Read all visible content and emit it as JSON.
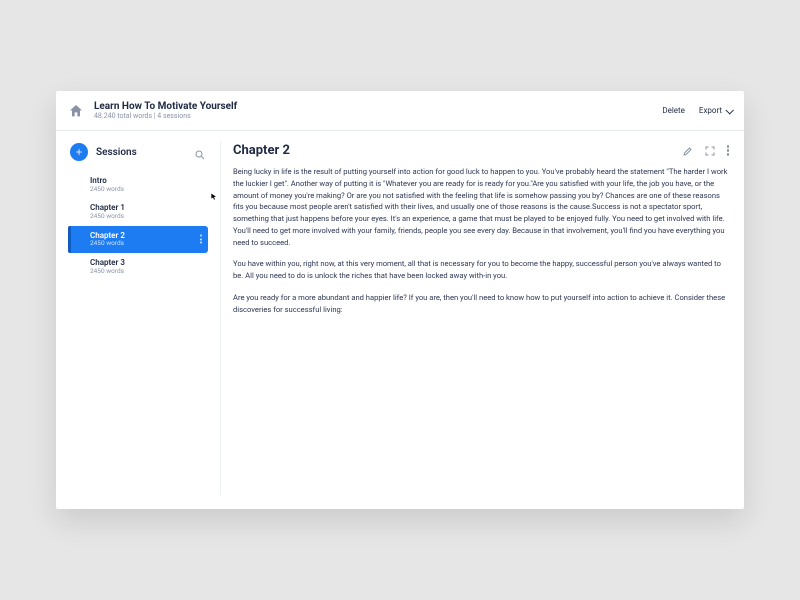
{
  "header": {
    "title": "Learn How To Motivate Yourself",
    "subtitle": "48.240 total words | 4 sessions",
    "delete": "Delete",
    "export": "Export"
  },
  "sidebar": {
    "heading": "Sessions",
    "items": [
      {
        "title": "Intro",
        "sub": "2450 words",
        "active": false
      },
      {
        "title": "Chapter 1",
        "sub": "2450 words",
        "active": false
      },
      {
        "title": "Chapter 2",
        "sub": "2450 words",
        "active": true
      },
      {
        "title": "Chapter 3",
        "sub": "2450 words",
        "active": false
      }
    ]
  },
  "main": {
    "title": "Chapter 2",
    "paragraphs": [
      "Being lucky in life is the result of putting yourself into action for good luck to happen to you. You've probably heard the statement \"The harder I work the luckier I get\". Another way of putting it is \"Whatever you are ready for is ready for you.\"Are you satisfied with your life, the job you have, or the amount of money you're making? Or are you not satisfied with the feeling that life is somehow passing you by? Chances are one of these reasons fits you because most people aren't satisfied with their lives, and usually one of those reasons is the cause.Success is not a spectator sport, something that just happens before your eyes. It's an experience, a game that must be played to be enjoyed fully. You need to get involved with life. You'll need to get more involved with your family, friends, people you see every day. Because in that involvement, you'll find you have everything you need to succeed.",
      "You have within you, right now, at this very moment, all that is necessary for you to become the happy, successful person you've always wanted to be. All you need to do is unlock the riches that have been locked away with-in you.",
      "Are you ready for a more abundant and happier life? If you are, then you'll need to know how to put yourself into action to achieve it. Consider these discoveries for successful living:"
    ]
  },
  "colors": {
    "accent": "#1e7cf2"
  }
}
